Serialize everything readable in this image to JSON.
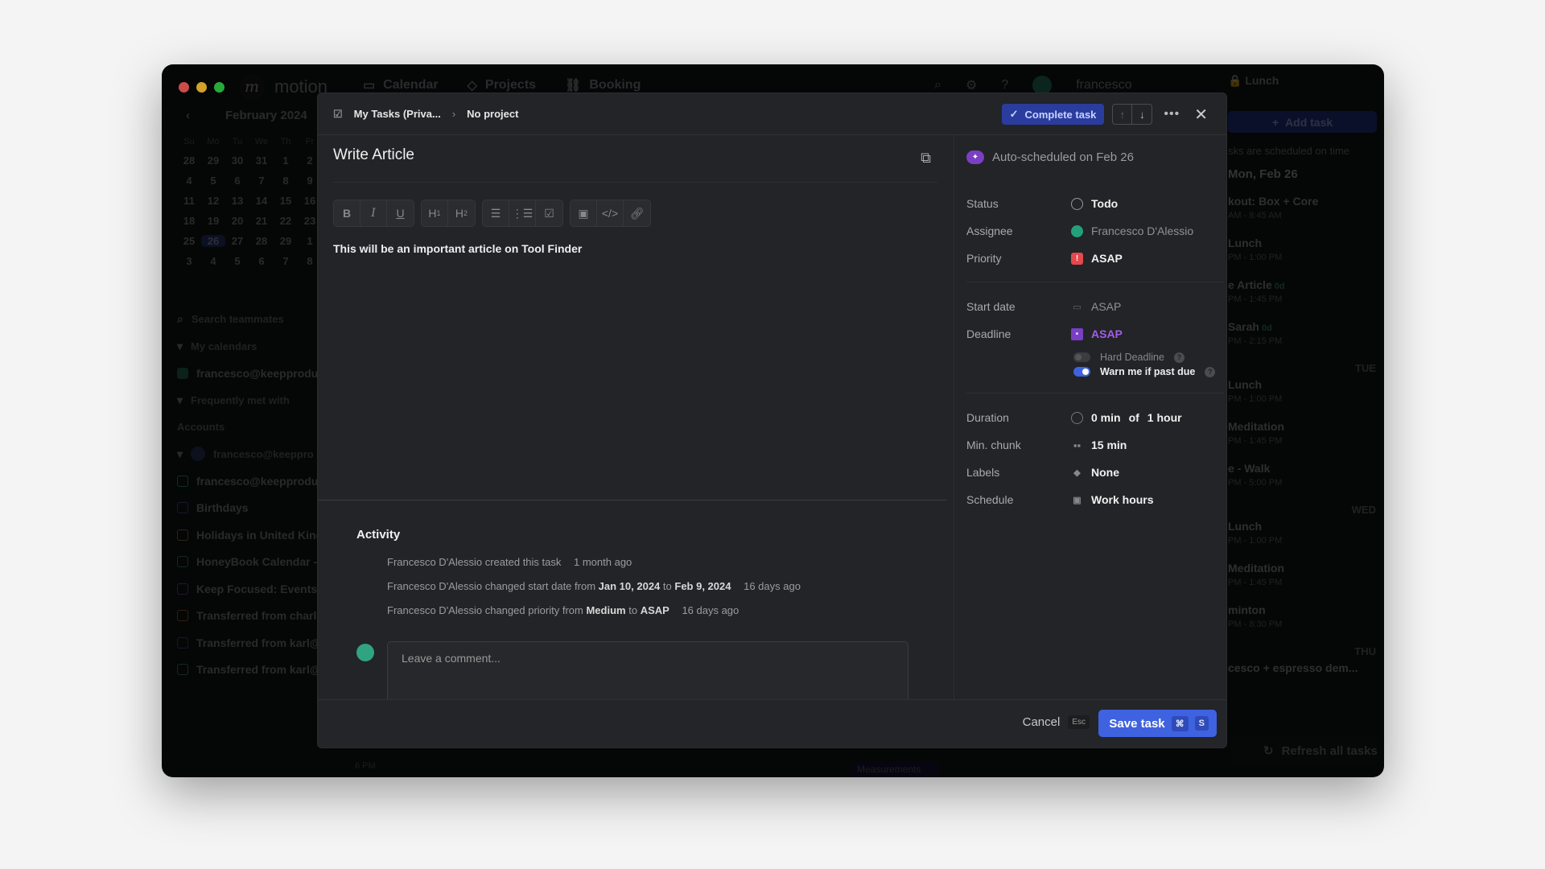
{
  "app": {
    "name": "motion",
    "nav": [
      {
        "label": "Calendar",
        "icon": "calendar-icon"
      },
      {
        "label": "Projects",
        "icon": "projects-icon"
      },
      {
        "label": "Booking",
        "icon": "link-icon"
      }
    ],
    "user": "francesco"
  },
  "sidebar": {
    "month_label": "February 2024",
    "weekdays": [
      "Su",
      "Mo",
      "Tu",
      "We",
      "Th",
      "Fr"
    ],
    "weeks": [
      [
        "28",
        "29",
        "30",
        "31",
        "1",
        "2"
      ],
      [
        "4",
        "5",
        "6",
        "7",
        "8",
        "9"
      ],
      [
        "11",
        "12",
        "13",
        "14",
        "15",
        "16"
      ],
      [
        "18",
        "19",
        "20",
        "21",
        "22",
        "23"
      ],
      [
        "25",
        "26",
        "27",
        "28",
        "29",
        "1"
      ],
      [
        "3",
        "4",
        "5",
        "6",
        "7",
        "8"
      ]
    ],
    "selected_day": "26",
    "search_placeholder": "Search teammates",
    "my_calendars_label": "My calendars",
    "my_calendar": "francesco@keepprodu",
    "frequently_met_label": "Frequently met with",
    "accounts_label": "Accounts",
    "account": "francesco@keeppro",
    "calendars": [
      {
        "label": "francesco@keepprodu",
        "color": "#2fa47f"
      },
      {
        "label": "Birthdays",
        "color": "#3b4bb0"
      },
      {
        "label": "Holidays in United King",
        "color": "#b07030"
      },
      {
        "label": "HoneyBook Calendar -",
        "color": "#2f8f6f"
      },
      {
        "label": "Keep Focused: Events",
        "color": "#8a3bb0"
      },
      {
        "label": "Transferred from charl",
        "color": "#b0602f"
      },
      {
        "label": "Transferred from karl@",
        "color": "#3b4bb0"
      },
      {
        "label": "Transferred from karl@",
        "color": "#2f8f6f"
      }
    ]
  },
  "right_panel": {
    "top_event": "Lunch",
    "add_task_label": "Add task",
    "status_text": "sks are scheduled on time",
    "day_header": "Mon, Feb 26",
    "items": [
      {
        "title": "kout: Box + Core",
        "time": "AM - 8:45 AM"
      },
      {
        "title": "Lunch",
        "time": "PM - 1:00 PM"
      },
      {
        "title": "e Article",
        "time": "PM - 1:45 PM",
        "badge": "0d"
      },
      {
        "title": "Sarah",
        "time": "PM - 2:15 PM",
        "badge": "0d"
      },
      {
        "day": "TUE"
      },
      {
        "title": "Lunch",
        "time": "PM - 1:00 PM"
      },
      {
        "title": "Meditation",
        "time": "PM - 1:45 PM"
      },
      {
        "title": "e - Walk",
        "time": "PM - 5:00 PM"
      },
      {
        "day": "WED"
      },
      {
        "title": "Lunch",
        "time": "PM - 1:00 PM"
      },
      {
        "title": "Meditation",
        "time": "PM - 1:45 PM"
      },
      {
        "title": "minton",
        "time": "PM - 8:30 PM"
      },
      {
        "day": "THU"
      },
      {
        "title": "cesco + espresso dem...",
        "time": ""
      }
    ],
    "refresh_label": "Refresh all tasks"
  },
  "background": {
    "time_label": "6 PM",
    "event_label": "Measurements"
  },
  "modal": {
    "breadcrumb": {
      "workspace": "My Tasks (Priva...",
      "project": "No project"
    },
    "complete_label": "Complete task",
    "title": "Write Article",
    "toolbar": [
      [
        "B",
        "I",
        "U"
      ],
      [
        "H1",
        "H2"
      ],
      [
        "bullet-list",
        "numbered-list",
        "checklist"
      ],
      [
        "image",
        "code",
        "link"
      ]
    ],
    "description": "This will be an important article on Tool Finder",
    "activity": {
      "heading": "Activity",
      "entries": [
        {
          "actor": "Francesco D'Alessio",
          "text": "created this task",
          "when": "1 month ago"
        },
        {
          "actor": "Francesco D'Alessio",
          "text": "changed start date from",
          "from": "Jan 10, 2024",
          "to": "Feb 9, 2024",
          "when": "16 days ago"
        },
        {
          "actor": "Francesco D'Alessio",
          "text": "changed priority from",
          "from": "Medium",
          "to": "ASAP",
          "when": "16 days ago"
        }
      ],
      "to_word": "to"
    },
    "comment_placeholder": "Leave a comment...",
    "cancel_label": "Cancel",
    "cancel_shortcut": "Esc",
    "save_label": "Save task",
    "save_shortcut": [
      "⌘",
      "S"
    ],
    "properties": {
      "auto_scheduled": "Auto-scheduled on Feb 26",
      "status": {
        "label": "Status",
        "value": "Todo"
      },
      "assignee": {
        "label": "Assignee",
        "value": "Francesco D'Alessio"
      },
      "priority": {
        "label": "Priority",
        "value": "ASAP",
        "color": "#e5484d"
      },
      "start_date": {
        "label": "Start date",
        "value": "ASAP"
      },
      "deadline": {
        "label": "Deadline",
        "value": "ASAP",
        "color": "#a35ce8"
      },
      "hard_deadline": {
        "label": "Hard Deadline",
        "enabled": false
      },
      "warn_past_due": {
        "label": "Warn me if past due",
        "enabled": true
      },
      "duration": {
        "label": "Duration",
        "done": "0 min",
        "of": "of",
        "total": "1 hour"
      },
      "min_chunk": {
        "label": "Min. chunk",
        "value": "15 min"
      },
      "labels": {
        "label": "Labels",
        "value": "None"
      },
      "schedule": {
        "label": "Schedule",
        "value": "Work hours"
      }
    }
  }
}
